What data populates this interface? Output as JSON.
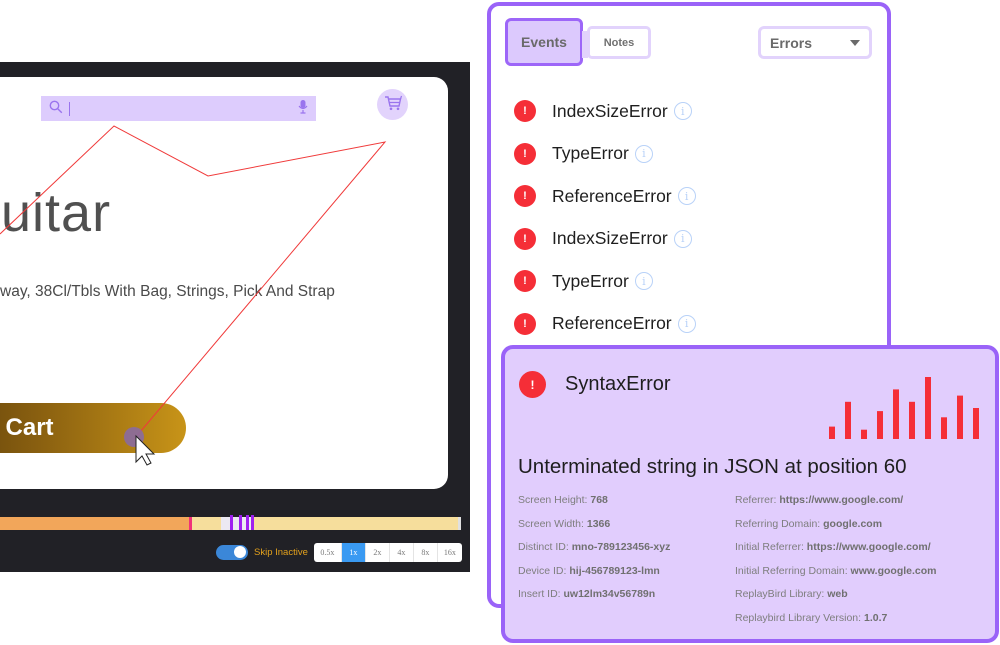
{
  "player": {
    "search": {
      "placeholder": "",
      "value": ""
    },
    "product": {
      "title": "Guitar",
      "description": "way, 38Cl/Tbls With Bag, Strings, Pick And Strap",
      "add_to_cart_label": "d To Cart"
    },
    "timeline": {
      "played_fraction": 0.41,
      "inactive_from": 0.48,
      "inactive_to": 0.55,
      "event_marks": [
        0.5,
        0.52,
        0.535,
        0.545
      ]
    },
    "controls": {
      "skip_inactive_label": "Skip Inactive",
      "skip_inactive_on": true,
      "speeds": [
        "0.5x",
        "1x",
        "2x",
        "4x",
        "8x",
        "16x"
      ],
      "active_speed": "1x"
    }
  },
  "panel": {
    "tabs": [
      {
        "label": "Events",
        "active": true
      },
      {
        "label": "Notes",
        "active": false
      }
    ],
    "filter": {
      "selected": "Errors"
    },
    "events": [
      {
        "name": "IndexSizeError",
        "icon": "error-icon"
      },
      {
        "name": "TypeError",
        "icon": "error-icon"
      },
      {
        "name": "ReferenceError",
        "icon": "error-icon"
      },
      {
        "name": "IndexSizeError",
        "icon": "error-icon"
      },
      {
        "name": "TypeError",
        "icon": "error-icon"
      },
      {
        "name": "ReferenceError",
        "icon": "error-icon"
      }
    ]
  },
  "detail": {
    "error_icon_glyph": "!",
    "title": "SyntaxError",
    "message": "Unterminated string in JSON at position 60",
    "sparkline": {
      "color": "#f52e37",
      "values": [
        2,
        6,
        1.5,
        4.5,
        8,
        6,
        10,
        3.5,
        7,
        5
      ]
    },
    "props_left": [
      {
        "label": "Screen Height: ",
        "value": "768"
      },
      {
        "label": "Screen Width: ",
        "value": "1366"
      },
      {
        "label": "Distinct ID: ",
        "value": "mno-789123456-xyz"
      },
      {
        "label": "Device ID: ",
        "value": "hij-456789123-lmn"
      },
      {
        "label": "Insert ID: ",
        "value": "uw12lm34v56789n"
      }
    ],
    "props_right": [
      {
        "label": "Referrer: ",
        "value": "https://www.google.com/"
      },
      {
        "label": "Referring Domain: ",
        "value": "google.com"
      },
      {
        "label": "Initial Referrer: ",
        "value": "https://www.google.com/"
      },
      {
        "label": "Initial Referring Domain: ",
        "value": "www.google.com"
      },
      {
        "label": "ReplayBird Library: ",
        "value": "web"
      },
      {
        "label": "Replaybird Library Version: ",
        "value": "1.0.7"
      }
    ]
  },
  "colors": {
    "accent": "#9a63f8",
    "accent_light": "#e1cdfd",
    "error": "#f52e37",
    "info": "#b9d2f8"
  }
}
